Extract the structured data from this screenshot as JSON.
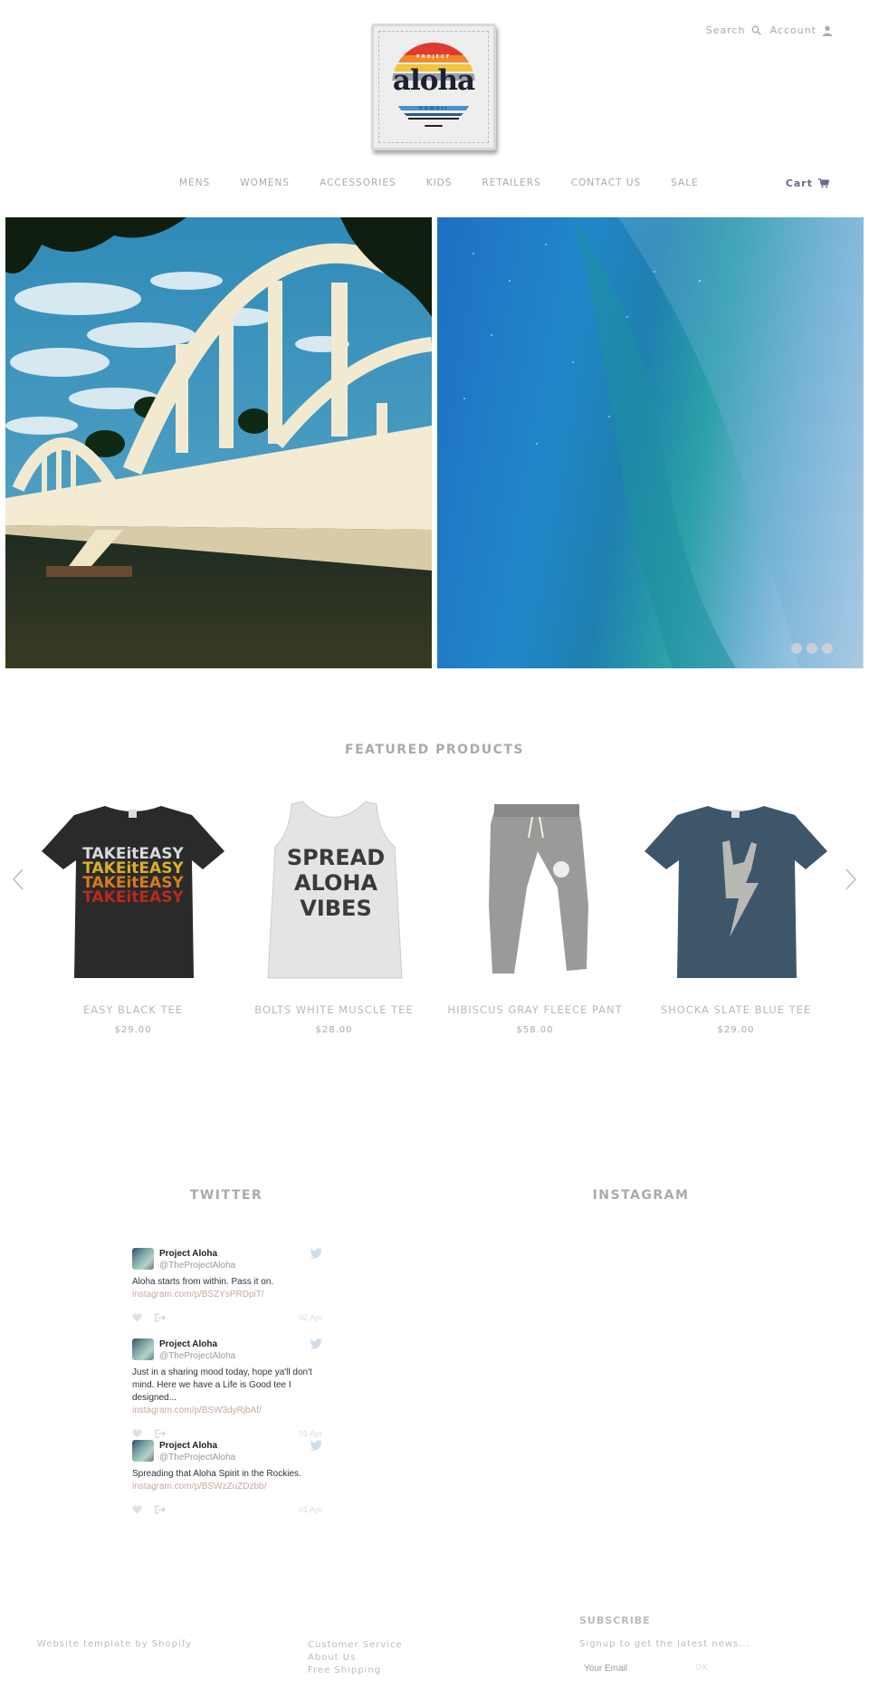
{
  "brand": {
    "logo_word": "aloha",
    "logo_top": "PROJECT",
    "logo_bottom": "HAWAII",
    "logo_colors": [
      "#e03a2e",
      "#f08a2a",
      "#f2c53a",
      "#9aa0a8",
      "#4a90d0",
      "#2a5a9a"
    ]
  },
  "header": {
    "search_label": "Search",
    "account_label": "Account",
    "cart_label": "Cart"
  },
  "nav": {
    "items": [
      "MENS",
      "WOMENS",
      "ACCESSORIES",
      "KIDS",
      "RETAILERS",
      "CONTACT US",
      "SALE"
    ]
  },
  "hero": {
    "slides": [
      "bridge-photo",
      "wave-photo"
    ],
    "dots_count": 3
  },
  "featured": {
    "title": "FEATURED PRODUCTS",
    "products": [
      {
        "name": "EASY BLACK TEE",
        "price": "$29.00",
        "image": "black-tee-take-it-easy"
      },
      {
        "name": "BOLTS WHITE MUSCLE TEE",
        "price": "$28.00",
        "image": "white-tank-spread-aloha-vibes"
      },
      {
        "name": "HIBISCUS GRAY FLEECE PANT",
        "price": "$58.00",
        "image": "gray-fleece-pant-hibiscus"
      },
      {
        "name": "SHOCKA SLATE BLUE TEE",
        "price": "$29.00",
        "image": "slate-blue-tee-shaka-bolt"
      }
    ],
    "tee_print_text": "TAKEitEASY",
    "tank_print_lines": [
      "SPREAD",
      "ALOHA",
      "VIBES"
    ]
  },
  "social": {
    "twitter_title": "TWITTER",
    "instagram_title": "INSTAGRAM",
    "tweets": [
      {
        "name": "Project Aloha",
        "handle": "@TheProjectAloha",
        "text": "Aloha starts from within. Pass it on.",
        "link": "instagram.com/p/BSZYsPRDpiT/",
        "date": "02 Apr"
      },
      {
        "name": "Project Aloha",
        "handle": "@TheProjectAloha",
        "text": "Just in a sharing mood today, hope ya'll don't mind. Here we have a Life is Good tee I designed...",
        "link": "instagram.com/p/BSW3dyRjbAf/",
        "date": "01 Apr"
      },
      {
        "name": "Project Aloha",
        "handle": "@TheProjectAloha",
        "text": "Spreading that Aloha Spirit in the Rockies.",
        "link": "instagram.com/p/BSWzZuZDzbb/",
        "date": "01 Apr"
      }
    ]
  },
  "footer": {
    "credit": "Website template by Shopify",
    "links": [
      "Customer Service",
      "About Us",
      "Free Shipping"
    ],
    "subscribe_title": "SUBSCRIBE",
    "subscribe_desc": "Signup to get the latest news...",
    "email_placeholder": "Your Email",
    "ok_label": "OK"
  }
}
